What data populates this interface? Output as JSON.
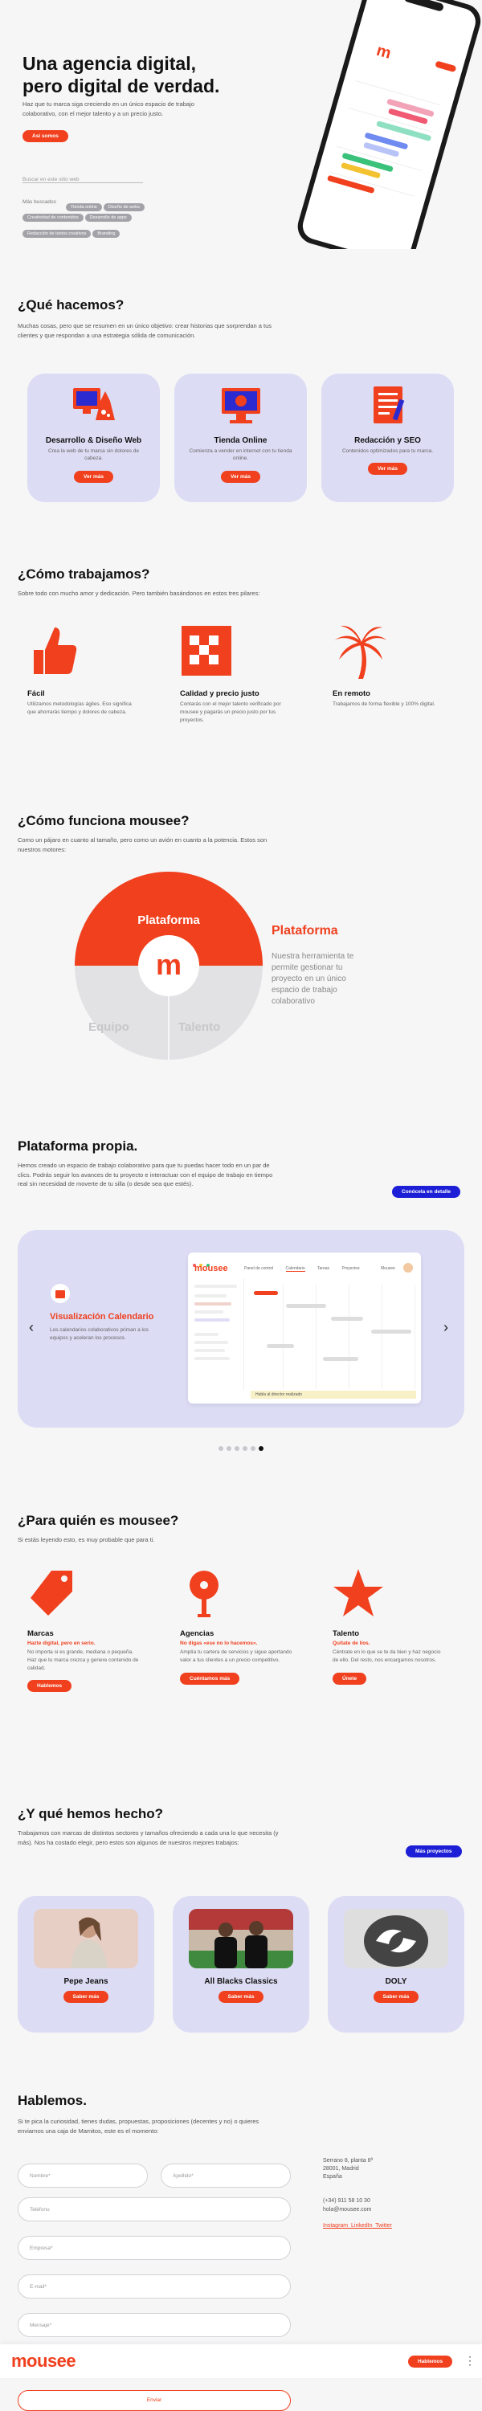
{
  "hero": {
    "title": "Una agencia digital,\npero digital de verdad.",
    "subtitle": "Haz que tu marca siga creciendo en un único espacio de trabajo colaborativo, con el mejor talento y a un precio justo.",
    "cta_label": "Así somos",
    "search_placeholder": "Buscar en este sitio web",
    "popular_label": "Más buscados",
    "chips": [
      "Tienda online",
      "Diseño de webs",
      "Creatividad de contenidos",
      "Desarrollo de apps",
      "Redacción de textos creativos",
      "Branding"
    ]
  },
  "que_hacemos": {
    "title": "¿Qué hacemos?",
    "desc": "Muchas cosas, pero que se resumen en un único objetivo: crear historias que sorprendan a tus clientes y que respondan a una estrategia sólida de comunicación.",
    "cards": [
      {
        "title": "Desarrollo & Diseño Web",
        "desc": "Crea la web de tu marca sin dolores de cabeza.",
        "cta": "Ver más"
      },
      {
        "title": "Tienda Online",
        "desc": "Comienza a vender en internet con tu tienda online.",
        "cta": "Ver más"
      },
      {
        "title": "Redacción y SEO",
        "desc": "Contenidos optimizados para tu marca.",
        "cta": "Ver más"
      }
    ],
    "prev_icon": "‹",
    "next_icon": "›"
  },
  "como_trabajamos": {
    "title": "¿Cómo trabajamos?",
    "desc": "Sobre todo con mucho amor y dedicación. Pero también basándonos en estos tres pilares:",
    "items": [
      {
        "title": "Fácil",
        "desc": "Utilizamos metodologías ágiles. Eso significa que ahorrarás tiempo y dolores de cabeza."
      },
      {
        "title": "Calidad y precio justo",
        "desc": "Contarás con el mejor talento verificado por mousee y pagarás un precio justo por tus proyectos."
      },
      {
        "title": "En remoto",
        "desc": "Trabajamos de forma flexible y 100% digital."
      }
    ]
  },
  "como_funciona": {
    "title": "¿Cómo funciona mousee?",
    "desc": "Como un pájaro en cuanto al tamaño, pero como un avión en cuanto a la potencia. Estos son nuestros motores:",
    "top_label": "Plataforma",
    "left_label": "Equipo",
    "right_label": "Talento",
    "center_letter": "m",
    "side_title": "Plataforma",
    "side_desc": "Nuestra herramienta te permite gestionar tu proyecto en un único espacio de trabajo colaborativo"
  },
  "plataforma": {
    "title": "Plataforma propia.",
    "desc": "Hemos creado un espacio de trabajo colaborativo para que tu puedas hacer todo en un par de clics. Podrás seguir los avances de tu proyecto e interactuar con el equipo de trabajo en tiempo real sin necesidad de moverte de tu silla (o desde sea que estés).",
    "cta": "Conócela en detalle",
    "slide_title": "Visualización Calendario",
    "slide_desc": "Los calendarios colaborativos priman a los equipos y aceleran los procesos.",
    "app_logo": "mousee",
    "app_tabs": [
      "Panel de control",
      "Calendario",
      "Tareas",
      "Proyectos"
    ],
    "app_user": "Mousee",
    "app_footer": "Habla al director realizado",
    "dots": 6,
    "active_dot": 5
  },
  "para_quien": {
    "title": "¿Para quién es mousee?",
    "desc": "Si estás leyendo esto, es muy probable que para ti.",
    "items": [
      {
        "title": "Marcas",
        "subtitle": "Hazte digital, pero en serio.",
        "desc": "No importa si es grande, mediana o pequeña. Haz que tu marca crezca y genere contenido de calidad.",
        "cta": "Hablemos"
      },
      {
        "title": "Agencias",
        "subtitle": "No digas «ese no lo hacemos».",
        "desc": "Amplía tu cartera de servicios y sigue aportando valor a tus clientes a un precio competitivo.",
        "cta": "Cuéntamos más"
      },
      {
        "title": "Talento",
        "subtitle": "Quítate de líos.",
        "desc": "Céntrate en lo que se te da bien y haz negocio de ello. Del resto, nos encargamos nosotros.",
        "cta": "Únete"
      }
    ]
  },
  "proyectos": {
    "title": "¿Y qué hemos hecho?",
    "desc": "Trabajamos con marcas de distintos sectores y tamaños ofreciendo a cada una lo que necesita (y más). Nos ha costado elegir, pero estos son algunos de nuestros mejores trabajos:",
    "cta": "Más proyectos",
    "cards": [
      {
        "title": "Pepe Jeans",
        "cta": "Saber más"
      },
      {
        "title": "All Blacks Classics",
        "cta": "Saber más"
      },
      {
        "title": "DOLY",
        "cta": "Saber más"
      }
    ]
  },
  "hablemos": {
    "title": "Hablemos.",
    "desc": "Si te pica la curiosidad, tienes dudas, propuestas, proposiciones (decentes y no) o quieres enviarnos una caja de Mamitos, este es el momento:",
    "fields": {
      "nombre": "Nombre*",
      "apellido": "Apellido*",
      "telefono": "Teléfono",
      "empresa": "Empresa*",
      "email": "E-mail*",
      "mensaje": "Mensaje*"
    },
    "address": [
      "Serrano 8, planta 6ª",
      "28001, Madrid",
      "España"
    ],
    "phone": "(+34) 911 58 10 30",
    "email": "hola@mousee.com",
    "social": "Instagram  LinkedIn  Twitter",
    "submit": "Enviar"
  },
  "footer": {
    "logo": "mousee",
    "cta": "Hablemos",
    "menu_icon": "⋮"
  },
  "colors": {
    "accent": "#f0401e",
    "blue": "#1c1fd6",
    "card": "#dcdcf4"
  }
}
